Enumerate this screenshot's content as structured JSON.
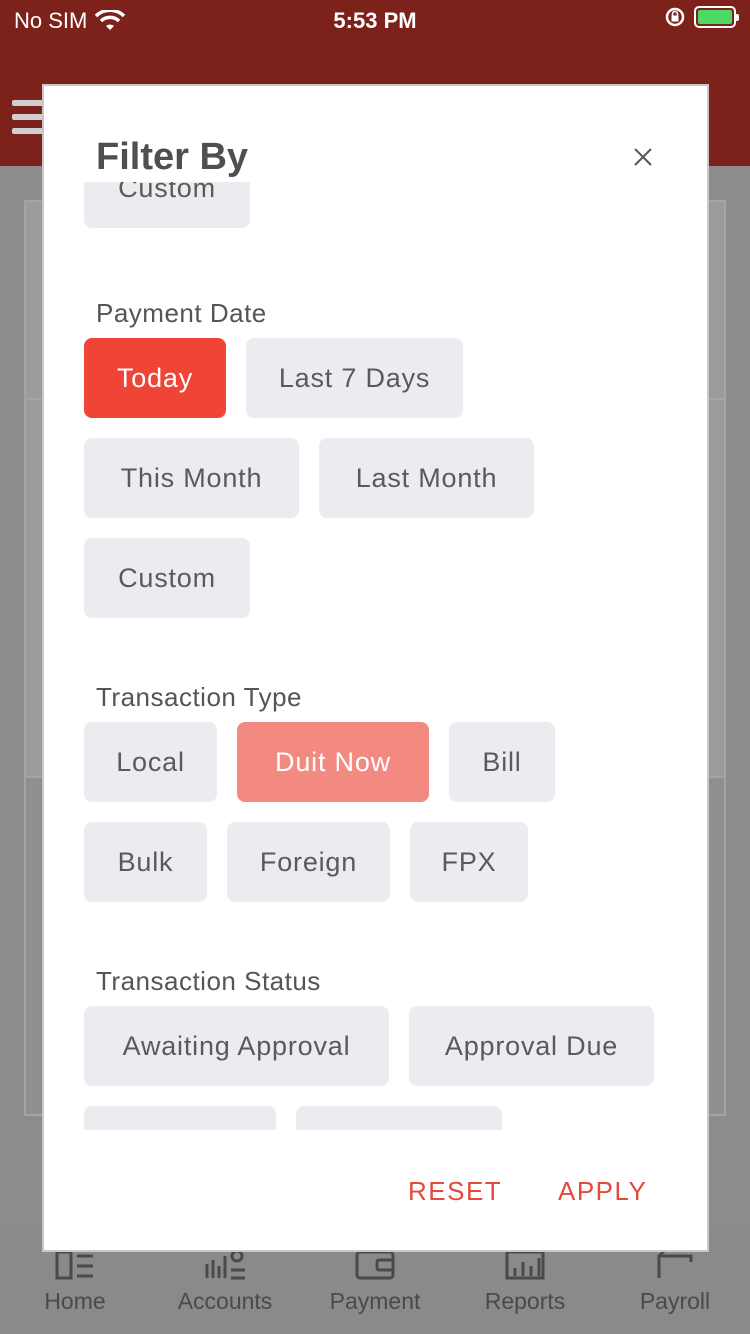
{
  "status_bar": {
    "carrier": "No SIM",
    "time": "5:53 PM"
  },
  "tabbar": [
    {
      "label": "Home",
      "icon": "home-icon"
    },
    {
      "label": "Accounts",
      "icon": "accounts-icon"
    },
    {
      "label": "Payment",
      "icon": "wallet-icon"
    },
    {
      "label": "Reports",
      "icon": "reports-icon"
    },
    {
      "label": "Payroll",
      "icon": "payroll-icon"
    }
  ],
  "modal": {
    "title": "Filter By",
    "partial_top_chip": "Custom",
    "payment_date": {
      "label": "Payment Date",
      "options": [
        "Today",
        "Last 7 Days",
        "This Month",
        "Last Month",
        "Custom"
      ],
      "selected": "Today"
    },
    "transaction_type": {
      "label": "Transaction Type",
      "options": [
        "Local",
        "Duit Now",
        "Bill",
        "Bulk",
        "Foreign",
        "FPX"
      ],
      "selected": "Duit Now"
    },
    "transaction_status": {
      "label": "Transaction Status",
      "options": [
        "Awaiting Approval",
        "Approval Due"
      ]
    },
    "reset_label": "RESET",
    "apply_label": "APPLY"
  },
  "colors": {
    "header": "#7d221b",
    "accent": "#f04437",
    "accent_soft": "#f38a82",
    "chip_bg": "#ebecef",
    "action_text": "#e5493a"
  }
}
